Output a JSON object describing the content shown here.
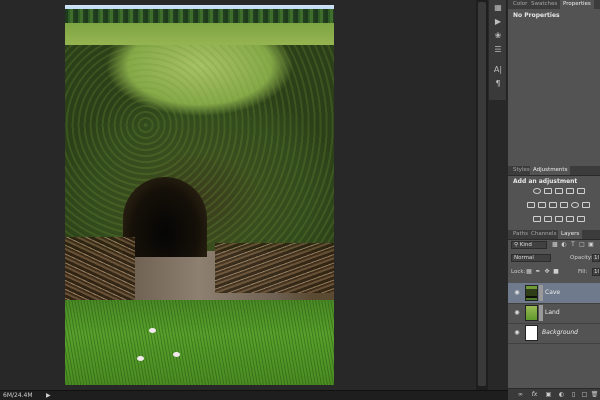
{
  "panels": {
    "top": {
      "tabs": [
        {
          "label": "Color",
          "active": false
        },
        {
          "label": "Swatches",
          "active": false
        },
        {
          "label": "Properties",
          "active": true
        }
      ],
      "message": "No Properties"
    },
    "adjustments": {
      "tabs": [
        {
          "label": "Styles",
          "active": false
        },
        {
          "label": "Adjustments",
          "active": true
        }
      ],
      "title": "Add an adjustment"
    },
    "layers": {
      "tabs": [
        {
          "label": "Paths",
          "active": false
        },
        {
          "label": "Channels",
          "active": false
        },
        {
          "label": "Layers",
          "active": true
        }
      ],
      "filter_kind": "Kind",
      "blend_mode": "Normal",
      "opacity_label": "Opacity:",
      "opacity_value": "10",
      "lock_label": "Lock:",
      "fill_label": "Fill:",
      "fill_value": "10",
      "items": [
        {
          "name": "Cave",
          "selected": true,
          "italic": false
        },
        {
          "name": "Land",
          "selected": false,
          "italic": false
        },
        {
          "name": "Background",
          "selected": false,
          "italic": true
        }
      ]
    }
  },
  "status": {
    "doc_size": "6M/24.4M"
  },
  "colors": {
    "workspace": "#282828",
    "panel": "#535353",
    "selected_layer": "#6f7a8c"
  }
}
